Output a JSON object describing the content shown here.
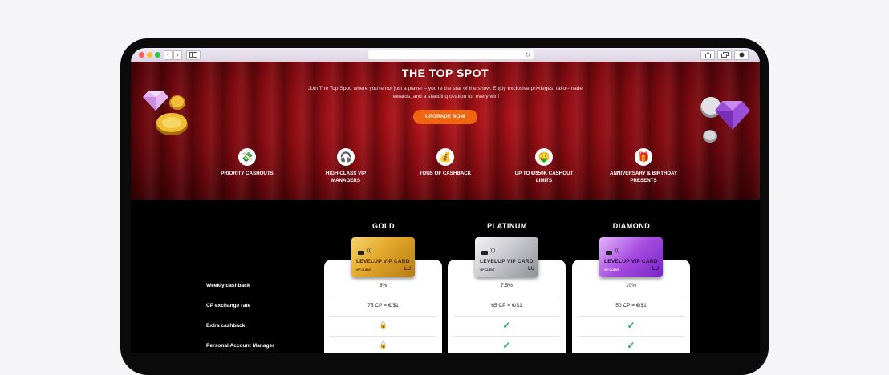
{
  "browser": {
    "back": "‹",
    "forward": "›",
    "reload": "↻"
  },
  "hero": {
    "title": "THE TOP SPOT",
    "subtitle": "Join The Top Spot, where you're not just a player – you're the star of the show. Enjoy exclusive privileges, tailor-made rewards, and a standing ovation for every win!",
    "cta": "UPGRADE NOW",
    "perks": [
      {
        "icon": "cash-stack-icon",
        "glyph": "💸",
        "label": "PRIORITY CASHOUTS"
      },
      {
        "icon": "headphones-icon",
        "glyph": "🎧",
        "label": "HIGH-CLASS VIP MANAGERS"
      },
      {
        "icon": "money-bag-icon",
        "glyph": "💰",
        "label": "TONS OF CASHBACK"
      },
      {
        "icon": "money-face-icon",
        "glyph": "🤑",
        "label": "UP TO €/$50K CASHOUT LIMITS"
      },
      {
        "icon": "gift-icon",
        "glyph": "🎁",
        "label": "ANNIVERSARY & BIRTHDAY PRESENTS"
      }
    ]
  },
  "tiers": [
    {
      "name": "GOLD",
      "card_title": "LEVELUP VIP CARD",
      "card_client": "VIP CLIENT",
      "card_logo": "LU",
      "color": "#e8b42a"
    },
    {
      "name": "PLATINUM",
      "card_title": "LEVELUP VIP CARD",
      "card_client": "VIP CLIENT",
      "card_logo": "LU",
      "color": "#c9c9cf"
    },
    {
      "name": "DIAMOND",
      "card_title": "LEVELUP VIP CARD",
      "card_client": "VIP CLIENT",
      "card_logo": "LU",
      "color": "#a64be0"
    }
  ],
  "rows": [
    {
      "label": "Weekly cashback",
      "values": [
        "5%",
        "7.5%",
        "10%"
      ]
    },
    {
      "label": "CP exchange rate",
      "values": [
        "75 CP = €/$1",
        "65 CP = €/$1",
        "50 CP = €/$1"
      ]
    },
    {
      "label": "Extra cashback",
      "values": [
        "lock",
        "check",
        "check"
      ]
    },
    {
      "label": "Personal Account Manager",
      "values": [
        "lock",
        "check",
        "check"
      ]
    }
  ],
  "colors": {
    "accent": "#f0650f",
    "check": "#1db44a",
    "hero_red": "#9e0f15"
  }
}
